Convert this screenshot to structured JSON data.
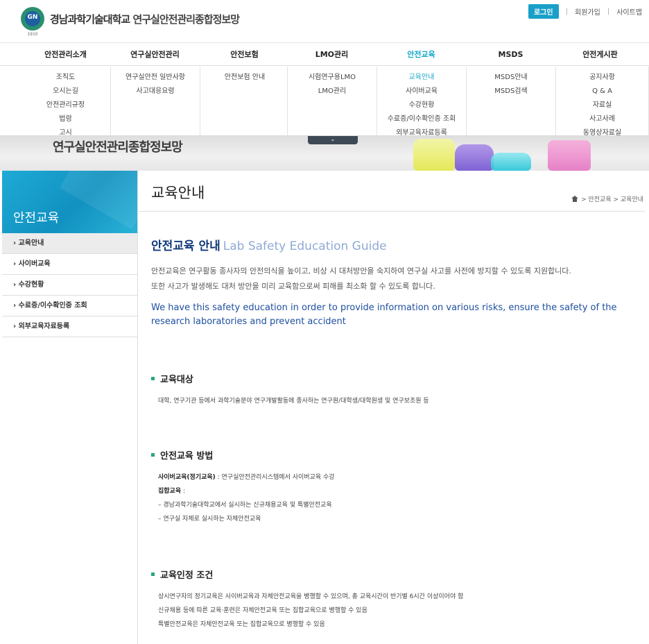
{
  "header": {
    "logo_emblem": "GN",
    "logo_year": "1910",
    "logo_text": "경남과학기술대학교",
    "logo_sub": "연구실안전관리종합정보망",
    "login": "로그인",
    "join": "회원가입",
    "sitemap": "사이트맵",
    "divider": "|"
  },
  "gnb": [
    {
      "label": "안전관리소개",
      "items": [
        "조직도",
        "오시는길",
        "안전관리규정",
        "법령",
        "고시"
      ]
    },
    {
      "label": "연구실안전관리",
      "items": [
        "연구실안전 일반사항",
        "사고대응요령"
      ]
    },
    {
      "label": "안전보험",
      "items": [
        "안전보험 안내"
      ]
    },
    {
      "label": "LMO관리",
      "items": [
        "시험연구용LMO",
        "LMO관리"
      ]
    },
    {
      "label": "안전교육",
      "items": [
        "교육안내",
        "사이버교육",
        "수강현황",
        "수료증/이수확인증 조회",
        "외부교육자료등록"
      ]
    },
    {
      "label": "MSDS",
      "items": [
        "MSDS안내",
        "MSDS검색"
      ]
    },
    {
      "label": "안전게시판",
      "items": [
        "공지사항",
        "Q & A",
        "자료실",
        "사고사례",
        "동영상자료실"
      ]
    }
  ],
  "banner": {
    "title": "연구실안전관리종합정보망",
    "toggle": "⌄"
  },
  "sidebar": {
    "title": "안전교육",
    "items": [
      {
        "label": "› 교육안내"
      },
      {
        "label": "› 사이버교육"
      },
      {
        "label": "› 수강현황"
      },
      {
        "label": "› 수료증/이수확인증 조회"
      },
      {
        "label": "› 외부교육자료등록"
      }
    ]
  },
  "main": {
    "title": "교육안내",
    "breadcrumb": "> 안전교육 > 교육안내",
    "intro_title": "안전교육 안내",
    "intro_title_en": "Lab Safety Education Guide",
    "intro_ko_1": "안전교육은 연구활동 종사자의 안전의식을 높이고, 비상 시 대처방안을 숙지하여 연구실 사고를 사전에 방지할 수 있도록 지원합니다.",
    "intro_ko_2": "또한 사고가 발생해도 대처 방안을 미리 교육함으로써 피해를 최소화 할 수 있도록 합니다.",
    "intro_en": "We have this safety education in order to provide information on various risks, ensure the safety of the research laboratories and prevent accident",
    "sections": [
      {
        "heading": "교육대상",
        "lines": [
          "대학, 연구기관 등에서 과학기술분야 연구개발활동에 종사하는 연구원/대학생/대학원생 및 연구보조원 등"
        ]
      },
      {
        "heading": "안전교육 방법",
        "lines": [
          "사이버교육(정기교육)",
          " : 연구실안전관리시스템에서 사이버교육 수강",
          "집합교육",
          " :",
          "– 경남과학기술대학교에서 실시하는 신규채용교육 및 특별안전교육",
          "– 연구실 자체로 실시하는 자체안전교육"
        ]
      },
      {
        "heading": "교육인정 조건",
        "lines": [
          "상시연구자의 정기교육은 사이버교육과 자체안전교육을 병행할 수 있으며, 총 교육시간이 반기별 6시간 이상이어야 함",
          "신규채용 등에 따른 교육·훈련은 자체안전교육 또는 집합교육으로 병행할 수 있음",
          "특별안전교육은 자체안전교육 또는 집합교육으로 병행할 수 있음"
        ]
      }
    ]
  }
}
